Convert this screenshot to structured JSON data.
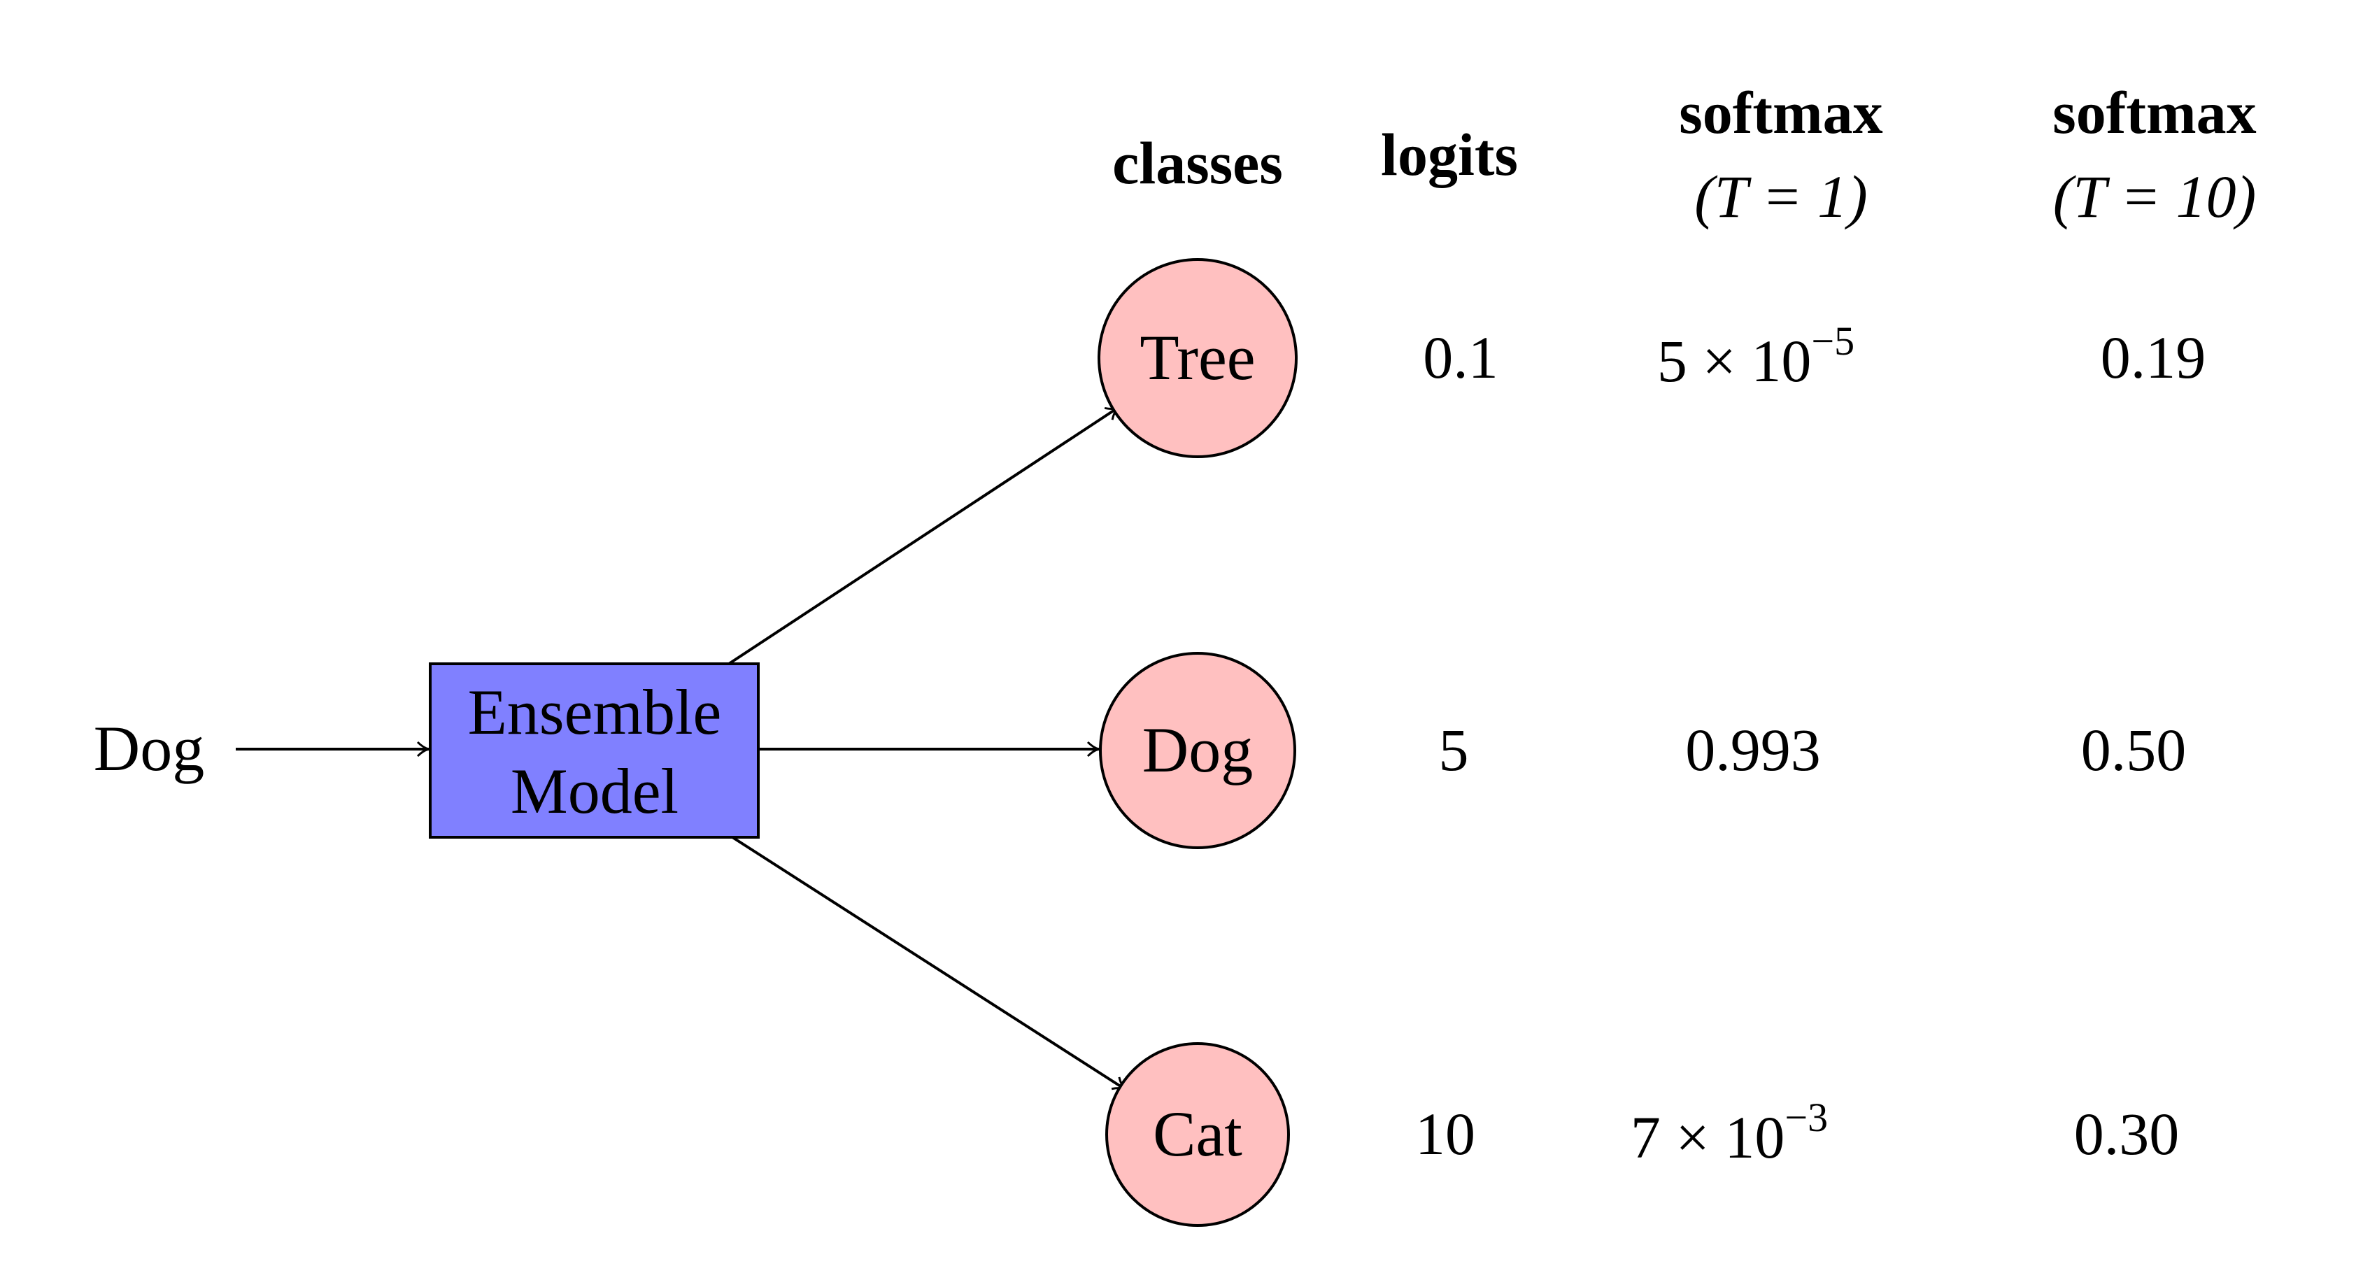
{
  "input": {
    "label": "Dog"
  },
  "model": {
    "line1": "Ensemble",
    "line2": "Model",
    "fill": "#8080FF"
  },
  "node_fill": "#FFC0C0",
  "headers": {
    "classes": "classes",
    "logits": "logits",
    "softmax_t1": {
      "title": "softmax",
      "sub": "(T = 1)"
    },
    "softmax_t10": {
      "title": "softmax",
      "sub": "(T = 10)"
    }
  },
  "rows": [
    {
      "class": "Tree",
      "logit": "0.1",
      "softmax_t1": {
        "mantissa": "5 × 10",
        "exp": "−5"
      },
      "softmax_t10": "0.19"
    },
    {
      "class": "Dog",
      "logit": "5",
      "softmax_t1": {
        "mantissa": "0.993",
        "exp": ""
      },
      "softmax_t10": "0.50"
    },
    {
      "class": "Cat",
      "logit": "10",
      "softmax_t1": {
        "mantissa": "7 × 10",
        "exp": "−3"
      },
      "softmax_t10": "0.30"
    }
  ]
}
